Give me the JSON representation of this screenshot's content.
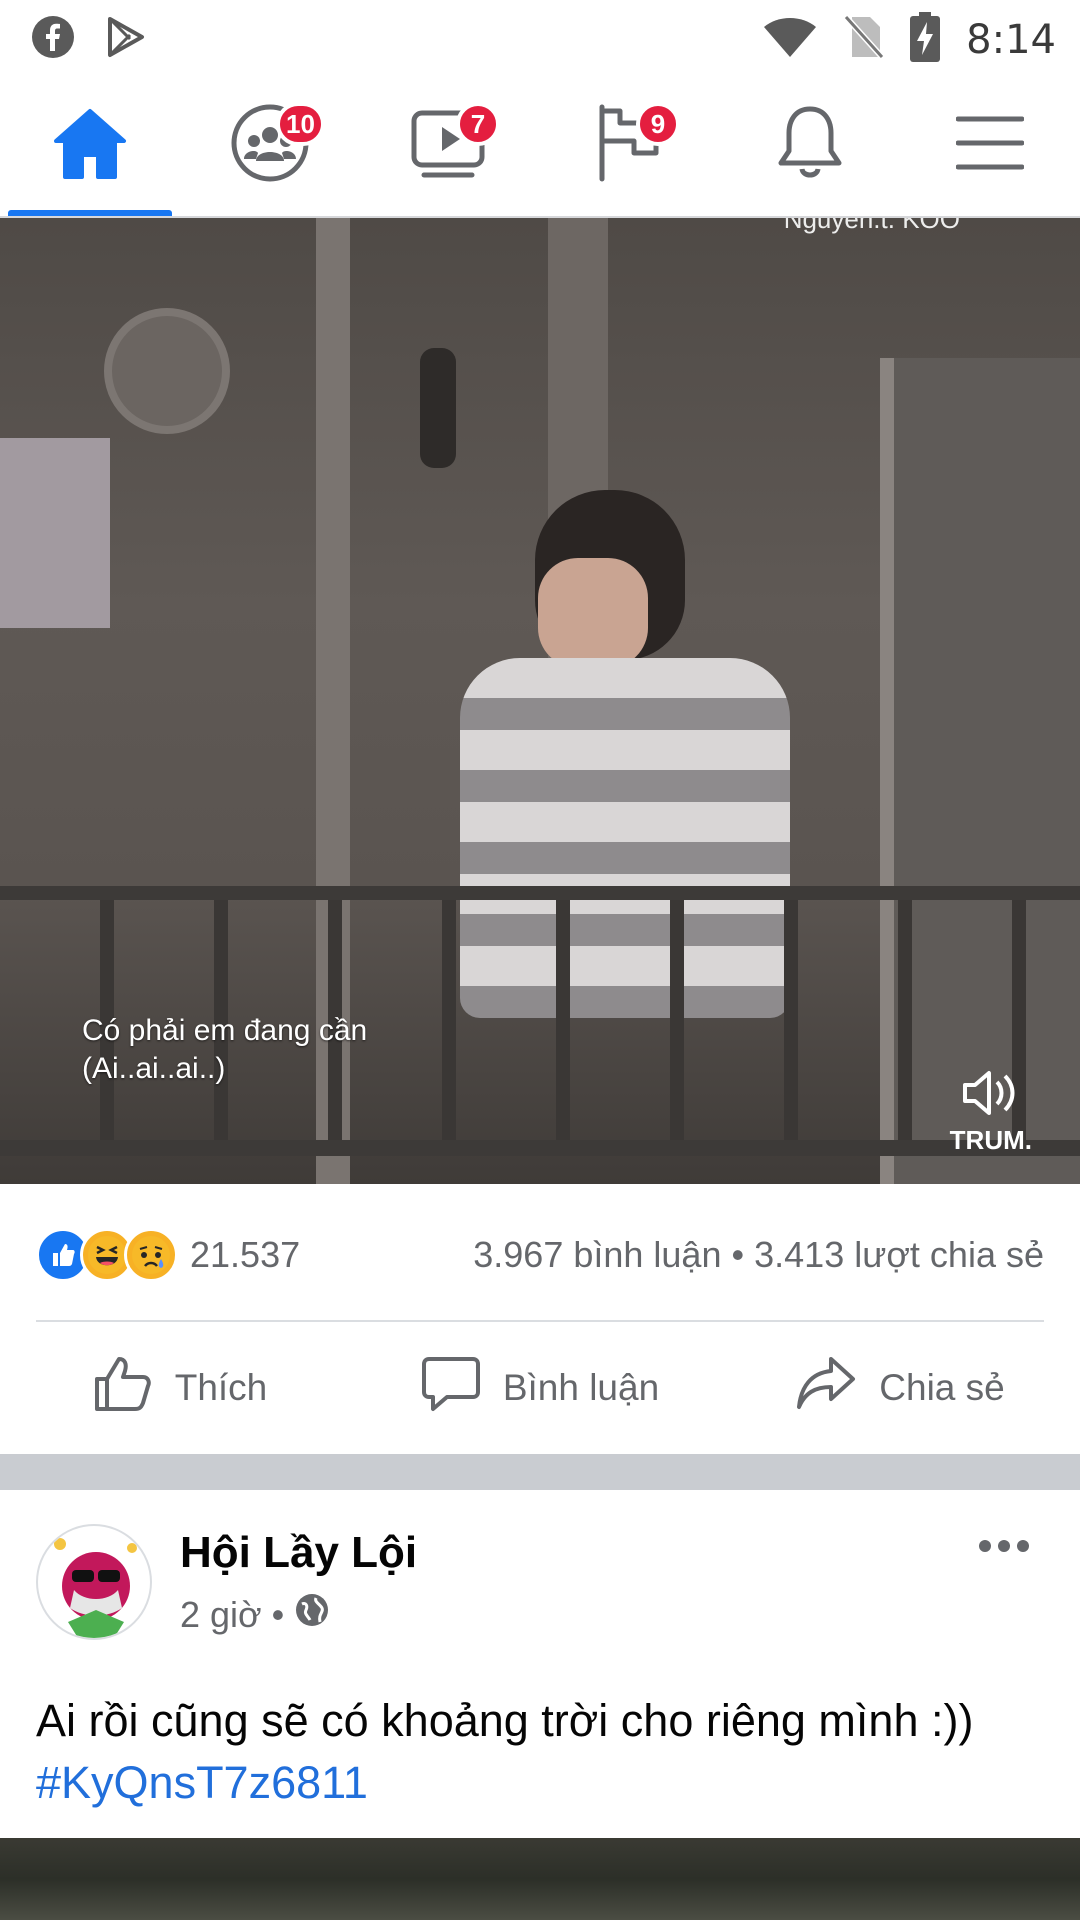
{
  "status_bar": {
    "time": "8:14",
    "left_icons": [
      "facebook-icon",
      "play-store-icon"
    ],
    "right_icons": [
      "wifi-icon",
      "no-sim-icon",
      "battery-charging-icon"
    ]
  },
  "nav": {
    "tabs": [
      {
        "name": "home",
        "badge": "",
        "active": true
      },
      {
        "name": "groups",
        "badge": "10",
        "active": false
      },
      {
        "name": "watch",
        "badge": "7",
        "active": false
      },
      {
        "name": "pages",
        "badge": "9",
        "active": false
      },
      {
        "name": "notifications",
        "badge": "",
        "active": false
      },
      {
        "name": "menu",
        "badge": "",
        "active": false
      }
    ],
    "accent": "#1877f2",
    "badge_color": "#e41e3f"
  },
  "video": {
    "caption_line1": "Có phải em đang cần",
    "caption_line2": "(Ai..ai..ai..)",
    "channel": "Nguyen.t. KOO",
    "watermark": "TRUM."
  },
  "post1": {
    "reaction_count": "21.537",
    "reactions": [
      "like",
      "haha",
      "sad"
    ],
    "comments": "3.967 bình luận",
    "shares": "3.413 lượt chia sẻ",
    "separator": "•",
    "actions": {
      "like": "Thích",
      "comment": "Bình luận",
      "share": "Chia sẻ"
    }
  },
  "post2": {
    "author": "Hội Lầy Lội",
    "time": "2 giờ",
    "separator": "•",
    "privacy_icon": "globe-icon",
    "text": "Ai rồi cũng sẽ có khoảng trời cho riêng mình :))",
    "hashtag": "#KyQnsT7z6811"
  }
}
